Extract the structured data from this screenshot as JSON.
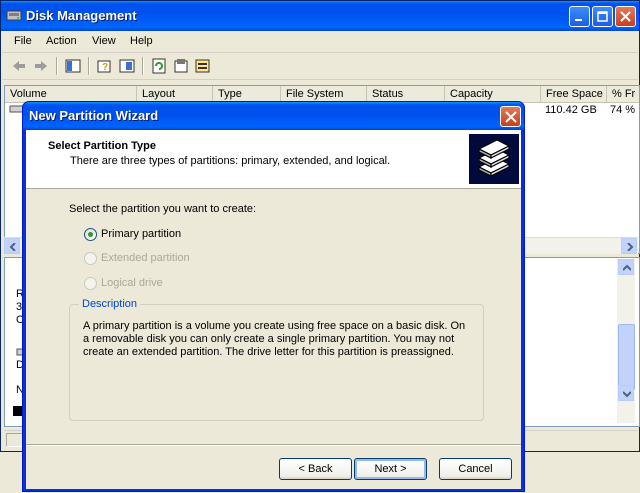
{
  "window": {
    "title": "Disk Management",
    "menu": [
      "File",
      "Action",
      "View",
      "Help"
    ]
  },
  "volume_list": {
    "columns": [
      "Volume",
      "Layout",
      "Type",
      "File System",
      "Status",
      "Capacity",
      "Free Space",
      "% Fr"
    ],
    "row": {
      "free_space": "110.42 GB",
      "pct_free": "74 %"
    }
  },
  "lower_pane_fragments": [
    "R",
    "3",
    "O",
    "D",
    "N"
  ],
  "wizard": {
    "title": "New Partition Wizard",
    "heading": "Select Partition Type",
    "subheading": "There are three types of partitions: primary, extended, and logical.",
    "prompt": "Select the partition you want to create:",
    "options": [
      {
        "label": "Primary partition",
        "selected": true,
        "enabled": true
      },
      {
        "label": "Extended partition",
        "selected": false,
        "enabled": false
      },
      {
        "label": "Logical drive",
        "selected": false,
        "enabled": false
      }
    ],
    "description_title": "Description",
    "description_text": "A primary partition is a volume you create using free space on a basic disk. On a removable disk you can only create a single primary partition. You may not create an extended partition. The drive letter for this partition is preassigned.",
    "buttons": {
      "back": "< Back",
      "next": "Next >",
      "cancel": "Cancel"
    }
  },
  "colors": {
    "titlebar": "#0054e3",
    "close_button": "#d4502e",
    "dialog_face": "#ece9d8",
    "radio_selected": "#21a121",
    "group_title": "#0046d5"
  }
}
